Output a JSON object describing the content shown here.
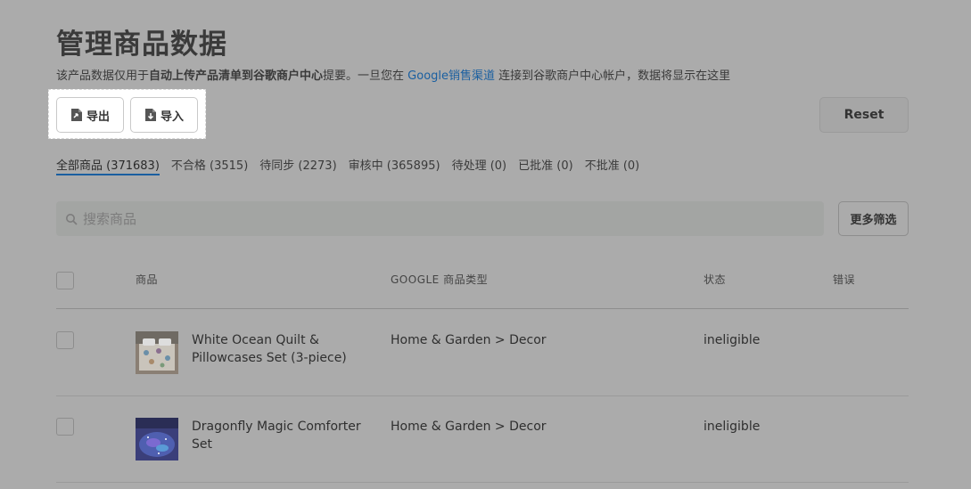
{
  "header": {
    "title": "管理商品数据",
    "subtitle_prefix": "该产品数据仅用于",
    "subtitle_bold": "自动上传产品清单到谷歌商户中心",
    "subtitle_mid": "提要。一旦您在 ",
    "subtitle_link": "Google销售渠道",
    "subtitle_suffix": " 连接到谷歌商户中心帐户，数据将显示在这里"
  },
  "toolbar": {
    "export_label": "导出",
    "import_label": "导入",
    "reset_label": "Reset"
  },
  "tabs": [
    {
      "label": "全部商品 (371683)",
      "active": true
    },
    {
      "label": "不合格 (3515)",
      "active": false
    },
    {
      "label": "待同步 (2273)",
      "active": false
    },
    {
      "label": "审核中 (365895)",
      "active": false
    },
    {
      "label": "待处理 (0)",
      "active": false
    },
    {
      "label": "已批准 (0)",
      "active": false
    },
    {
      "label": "不批准 (0)",
      "active": false
    }
  ],
  "search": {
    "placeholder": "搜索商品",
    "filter_label": "更多筛选"
  },
  "table": {
    "columns": [
      "商品",
      "GOOGLE 商品类型",
      "状态",
      "错误"
    ],
    "rows": [
      {
        "name": "White Ocean Quilt & Pillowcases Set (3-piece)",
        "type": "Home & Garden > Decor",
        "status": "ineligible",
        "error": ""
      },
      {
        "name": "Dragonfly Magic Comforter Set",
        "type": "Home & Garden > Decor",
        "status": "ineligible",
        "error": ""
      }
    ]
  },
  "colors": {
    "background": "#ababab",
    "accent": "#1a5fa0"
  }
}
